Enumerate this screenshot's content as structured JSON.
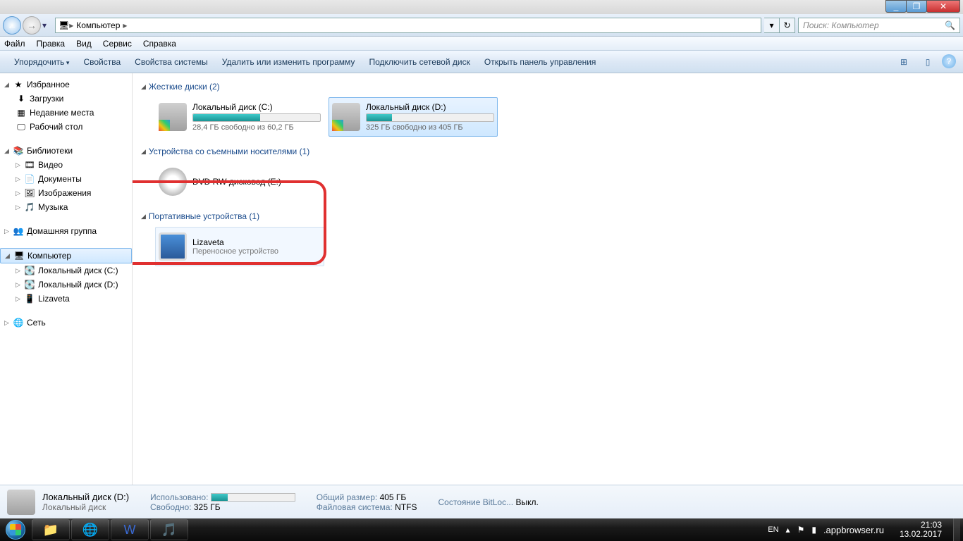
{
  "window": {
    "minimize": "_",
    "maximize": "❐",
    "close": "✕"
  },
  "nav": {
    "back": "←",
    "forward": "→",
    "dropdown": "▾",
    "breadcrumb_root": "Компьютер",
    "sep": "▸",
    "refresh": "↻",
    "history": "▾",
    "search_placeholder": "Поиск: Компьютер",
    "search_icon": "🔍"
  },
  "menu": {
    "file": "Файл",
    "edit": "Правка",
    "view": "Вид",
    "service": "Сервис",
    "help": "Справка"
  },
  "toolbar": {
    "organize": "Упорядочить",
    "properties": "Свойства",
    "sysprops": "Свойства системы",
    "uninstall": "Удалить или изменить программу",
    "netdrive": "Подключить сетевой диск",
    "ctrlpanel": "Открыть панель управления",
    "view_icon": "⊞",
    "preview_icon": "▯",
    "help_icon": "?"
  },
  "sidebar": {
    "favorites": "Избранное",
    "downloads": "Загрузки",
    "recent": "Недавние места",
    "desktop": "Рабочий стол",
    "libraries": "Библиотеки",
    "video": "Видео",
    "documents": "Документы",
    "images": "Изображения",
    "music": "Музыка",
    "homegroup": "Домашняя группа",
    "computer": "Компьютер",
    "drive_c": "Локальный диск (C:)",
    "drive_d": "Локальный диск (D:)",
    "lizaveta": "Lizaveta",
    "network": "Сеть"
  },
  "sections": {
    "hdd": "Жесткие диски (2)",
    "removable": "Устройства со съемными носителями (1)",
    "portable": "Портативные устройства (1)"
  },
  "drives": {
    "c": {
      "name": "Локальный диск (C:)",
      "free": "28,4 ГБ свободно из 60,2 ГБ",
      "fill": 53
    },
    "d": {
      "name": "Локальный диск (D:)",
      "free": "325 ГБ свободно из 405 ГБ",
      "fill": 20
    },
    "dvd": {
      "name": "DVD RW дисковод (E:)"
    },
    "liz": {
      "name": "Lizaveta",
      "sub": "Переносное устройство"
    }
  },
  "details": {
    "title": "Локальный диск (D:)",
    "subtitle": "Локальный диск",
    "used_lbl": "Использовано:",
    "used_fill": 20,
    "free_lbl": "Свободно:",
    "free_val": "325 ГБ",
    "total_lbl": "Общий размер:",
    "total_val": "405 ГБ",
    "fs_lbl": "Файловая система:",
    "fs_val": "NTFS",
    "bitloc_lbl": "Состояние BitLoc...",
    "bitloc_val": "Выкл."
  },
  "taskbar": {
    "lang": "EN",
    "time": "21:03",
    "date": "13.02.2017",
    "watermark": ".appbrowser.ru",
    "tray_up": "▴",
    "tray_flag": "⚑",
    "tray_bat": "▮"
  }
}
